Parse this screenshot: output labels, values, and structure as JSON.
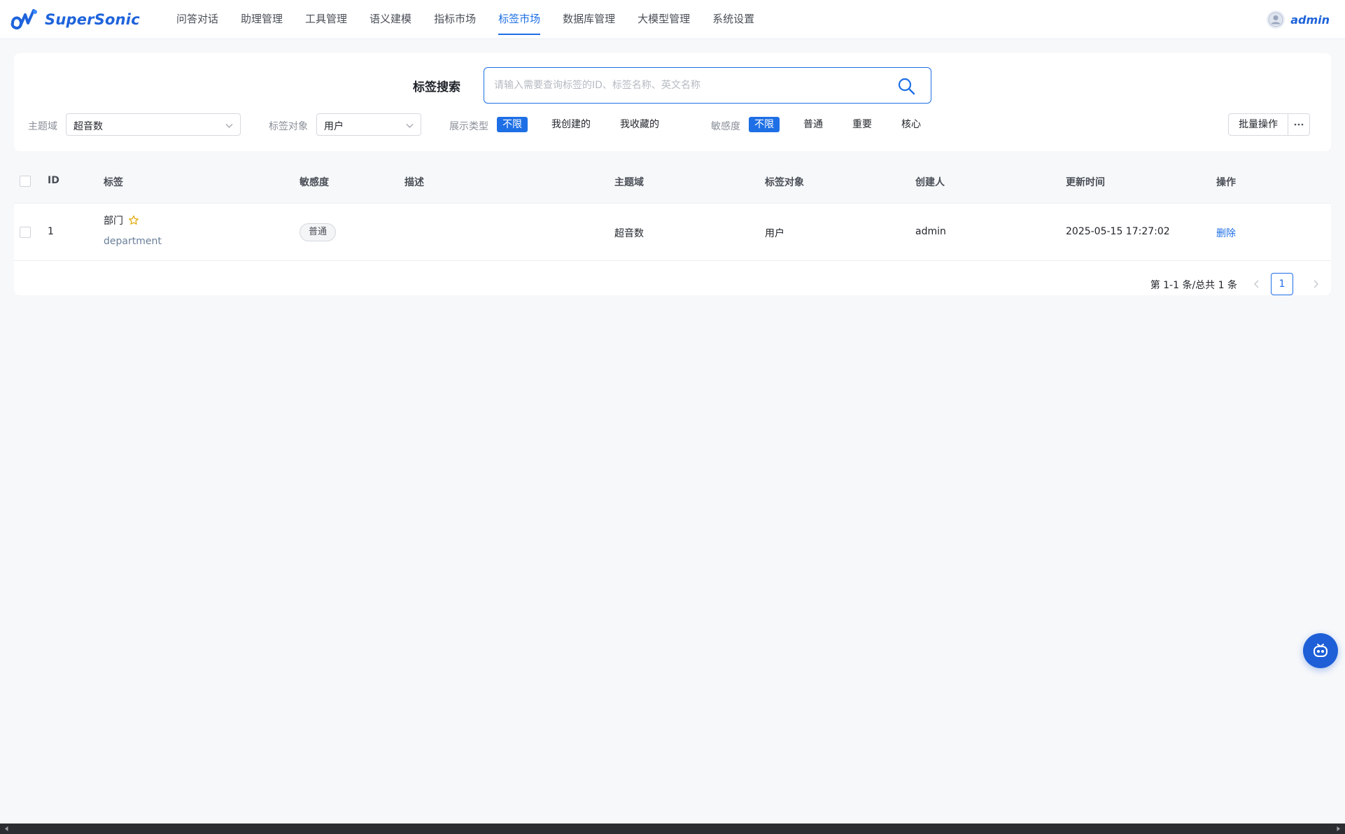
{
  "app": {
    "logo_text": "SuperSonic",
    "brand_color": "#1e6fe5",
    "user_name": "admin"
  },
  "nav": {
    "items": [
      {
        "label": "问答对话"
      },
      {
        "label": "助理管理"
      },
      {
        "label": "工具管理"
      },
      {
        "label": "语义建模"
      },
      {
        "label": "指标市场"
      },
      {
        "label": "标签市场"
      },
      {
        "label": "数据库管理"
      },
      {
        "label": "大模型管理"
      },
      {
        "label": "系统设置"
      }
    ],
    "active": "标签市场"
  },
  "search": {
    "title": "标签搜索",
    "placeholder": "请输入需要查询标签的ID、标签名称、英文名称",
    "value": ""
  },
  "filters": {
    "domain_label": "主题域",
    "domain_value": "超音数",
    "object_label": "标签对象",
    "object_value": "用户",
    "display_type_label": "展示类型",
    "display_type_options": [
      "不限",
      "我创建的",
      "我收藏的"
    ],
    "display_type_selected": "不限",
    "sensitivity_label": "敏感度",
    "sensitivity_options": [
      "不限",
      "普通",
      "重要",
      "核心"
    ],
    "sensitivity_selected": "不限",
    "batch_label": "批量操作",
    "more_label": "···"
  },
  "table": {
    "columns": [
      "ID",
      "标签",
      "敏感度",
      "描述",
      "主题域",
      "标签对象",
      "创建人",
      "更新时间",
      "操作"
    ],
    "rows": [
      {
        "id": "1",
        "name": "部门",
        "en_name": "department",
        "sensitivity": "普通",
        "description": "",
        "domain": "超音数",
        "object": "用户",
        "creator": "admin",
        "updated_at": "2025-05-15 17:27:02",
        "action": "删除"
      }
    ]
  },
  "pagination": {
    "total_text": "第 1-1 条/总共 1 条",
    "current_page": "1"
  }
}
